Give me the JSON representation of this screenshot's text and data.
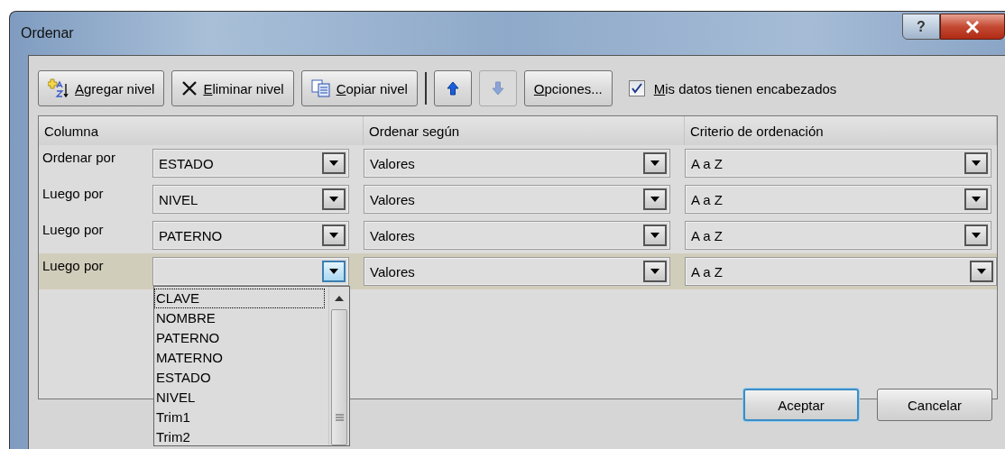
{
  "window": {
    "title": "Ordenar",
    "help": "?"
  },
  "toolbar": {
    "buttons": [
      {
        "kind": "add",
        "label": "Agregar nivel",
        "disabled": false
      },
      {
        "kind": "delete",
        "label": "Eliminar nivel",
        "disabled": false
      },
      {
        "kind": "copy",
        "label": "Copiar nivel",
        "disabled": false
      },
      {
        "kind": "up",
        "disabled": false
      },
      {
        "kind": "down",
        "disabled": true
      },
      {
        "kind": "text",
        "label": "Opciones...",
        "disabled": false
      }
    ],
    "checkbox": {
      "label": "Mis datos tienen encabezados",
      "checked": true
    }
  },
  "grid": {
    "columns": [
      "Columna",
      "Ordenar según",
      "Criterio de ordenación"
    ],
    "rows": [
      {
        "label": "Ordenar por",
        "column": "ESTADO",
        "sort_on": "Valores",
        "order": "A a Z",
        "selected": false,
        "open": false
      },
      {
        "label": "Luego por",
        "column": "NIVEL",
        "sort_on": "Valores",
        "order": "A a Z",
        "selected": false,
        "open": false
      },
      {
        "label": "Luego por",
        "column": "PATERNO",
        "sort_on": "Valores",
        "order": "A a Z",
        "selected": false,
        "open": false
      },
      {
        "label": "Luego por",
        "sort_on": "Valores",
        "order": "A a Z",
        "selected": true,
        "open": true
      }
    ]
  },
  "dropdown_list": [
    {
      "label": "CLAVE",
      "selected": true
    },
    {
      "label": "NOMBRE",
      "selected": false
    },
    {
      "label": "PATERNO",
      "selected": false
    },
    {
      "label": "MATERNO",
      "selected": false
    },
    {
      "label": "ESTADO",
      "selected": false
    },
    {
      "label": "NIVEL",
      "selected": false
    },
    {
      "label": "Trim1",
      "selected": false
    },
    {
      "label": "Trim2",
      "selected": false
    }
  ],
  "buttons": [
    {
      "label": "Aceptar",
      "default": true
    },
    {
      "label": "Cancelar",
      "default": false
    }
  ]
}
